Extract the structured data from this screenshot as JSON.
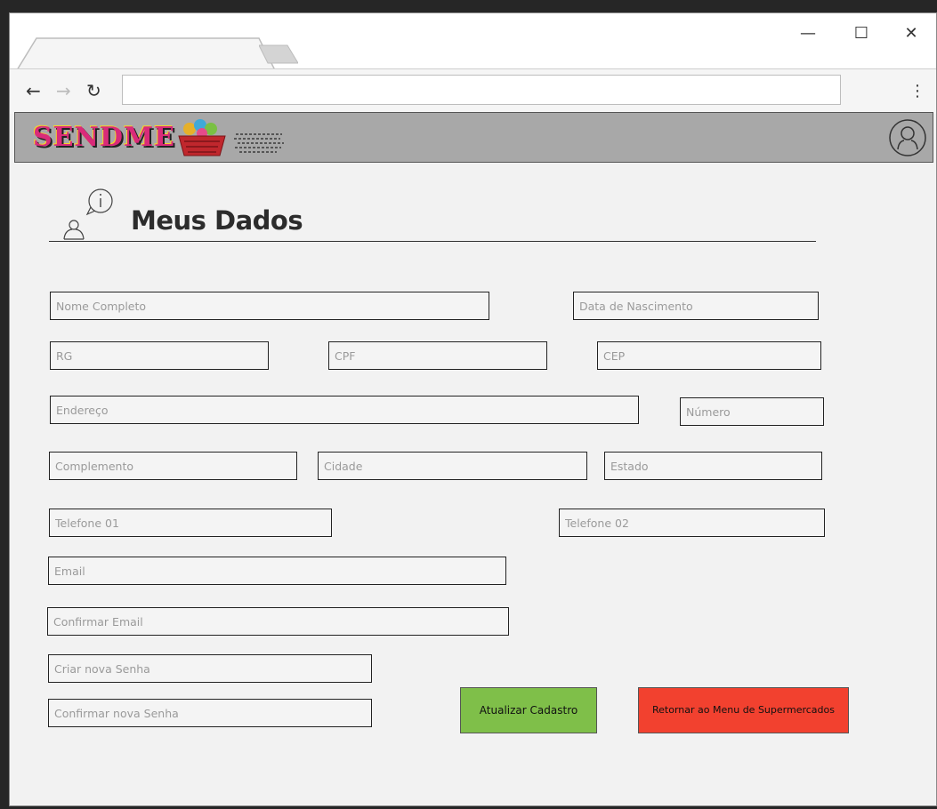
{
  "header": {
    "logo_text": "SENDME"
  },
  "page": {
    "title": "Meus Dados"
  },
  "form": {
    "nome_completo": "Nome Completo",
    "data_nascimento": "Data de Nascimento",
    "rg": "RG",
    "cpf": "CPF",
    "cep": "CEP",
    "endereco": "Endereço",
    "numero": "Número",
    "complemento": "Complemento",
    "cidade": "Cidade",
    "estado": "Estado",
    "telefone_01": "Telefone 01",
    "telefone_02": "Telefone 02",
    "email": "Email",
    "confirmar_email": "Confirmar Email",
    "criar_senha": "Criar nova Senha",
    "confirmar_senha": "Confirmar nova Senha"
  },
  "buttons": {
    "atualizar": "Atualizar Cadastro",
    "retornar": "Retornar ao Menu de Supermercados"
  },
  "colors": {
    "primary_button": "#7fbf49",
    "secondary_button": "#f2412f",
    "app_bar": "#a8a8a8"
  },
  "icons": [
    "back-arrow-icon",
    "forward-arrow-icon",
    "reload-icon",
    "menu-dots-icon",
    "minimize-icon",
    "maximize-icon",
    "close-icon",
    "user-profile-icon",
    "user-info-icon"
  ]
}
